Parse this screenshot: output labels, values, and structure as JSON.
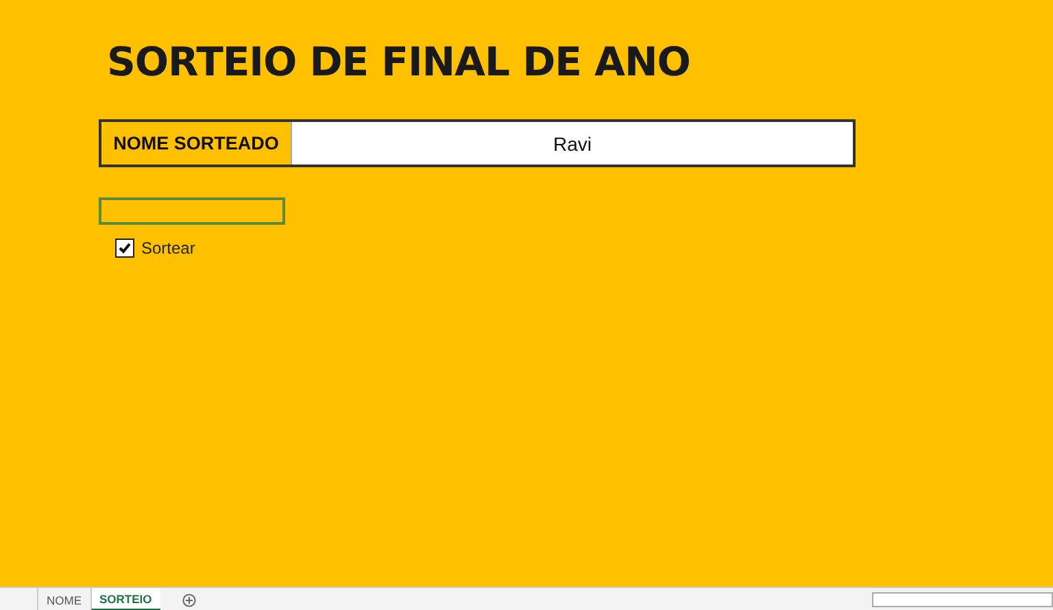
{
  "title": "SORTEIO DE FINAL DE ANO",
  "result": {
    "label": "NOME SORTEADO",
    "value": "Ravi"
  },
  "checkbox": {
    "label": "Sortear",
    "checked": true
  },
  "sheet_tabs": [
    {
      "label": "NOME",
      "selected": false
    },
    {
      "label": "SORTEIO",
      "selected": true
    }
  ]
}
